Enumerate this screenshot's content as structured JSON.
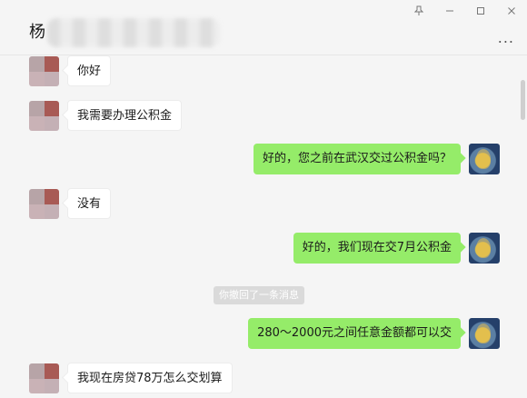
{
  "header": {
    "contact_name": "杨",
    "more_label": "...",
    "controls": {
      "pin_icon": "pin-icon",
      "minimize_icon": "minimize-icon",
      "maximize_icon": "maximize-icon",
      "close_icon": "close-icon"
    }
  },
  "messages": [
    {
      "side": "in",
      "text": "你好"
    },
    {
      "side": "in",
      "text": "我需要办理公积金"
    },
    {
      "side": "out",
      "text": "好的，您之前在武汉交过公积金吗？"
    },
    {
      "side": "in",
      "text": "没有"
    },
    {
      "side": "out",
      "text": "好的，我们现在交7月公积金"
    },
    {
      "side": "system",
      "text": "你撤回了一条消息"
    },
    {
      "side": "out",
      "text": "280～2000元之间任意金额都可以交"
    },
    {
      "side": "in",
      "text": "我现在房贷78万怎么交划算"
    }
  ],
  "colors": {
    "outgoing_bubble": "#95ec69",
    "incoming_bubble": "#ffffff",
    "background": "#f5f5f5"
  }
}
